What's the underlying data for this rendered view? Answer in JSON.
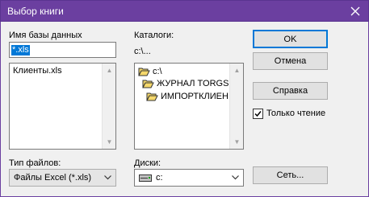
{
  "window": {
    "title": "Выбор книги",
    "close_icon": "close-icon"
  },
  "filename": {
    "label": "Имя базы данных",
    "value": "*.xls",
    "files": [
      "Клиенты.xls"
    ]
  },
  "directories": {
    "label": "Каталоги:",
    "current_path": "c:\\...",
    "items": [
      "c:\\",
      "ЖУРНАЛ TORGS",
      "ИМПОРТКЛИЕН"
    ]
  },
  "buttons": {
    "ok": "OK",
    "cancel": "Отмена",
    "help": "Справка",
    "network": "Сеть..."
  },
  "readonly": {
    "label": "Только чтение",
    "checked": true
  },
  "file_type": {
    "label": "Тип файлов:",
    "value": "Файлы Excel (*.xls)"
  },
  "drives": {
    "label": "Диски:",
    "value": "c:"
  },
  "colors": {
    "titlebar": "#6b3fa0",
    "selection": "#0078d7",
    "default_button_border": "#0078d7"
  }
}
